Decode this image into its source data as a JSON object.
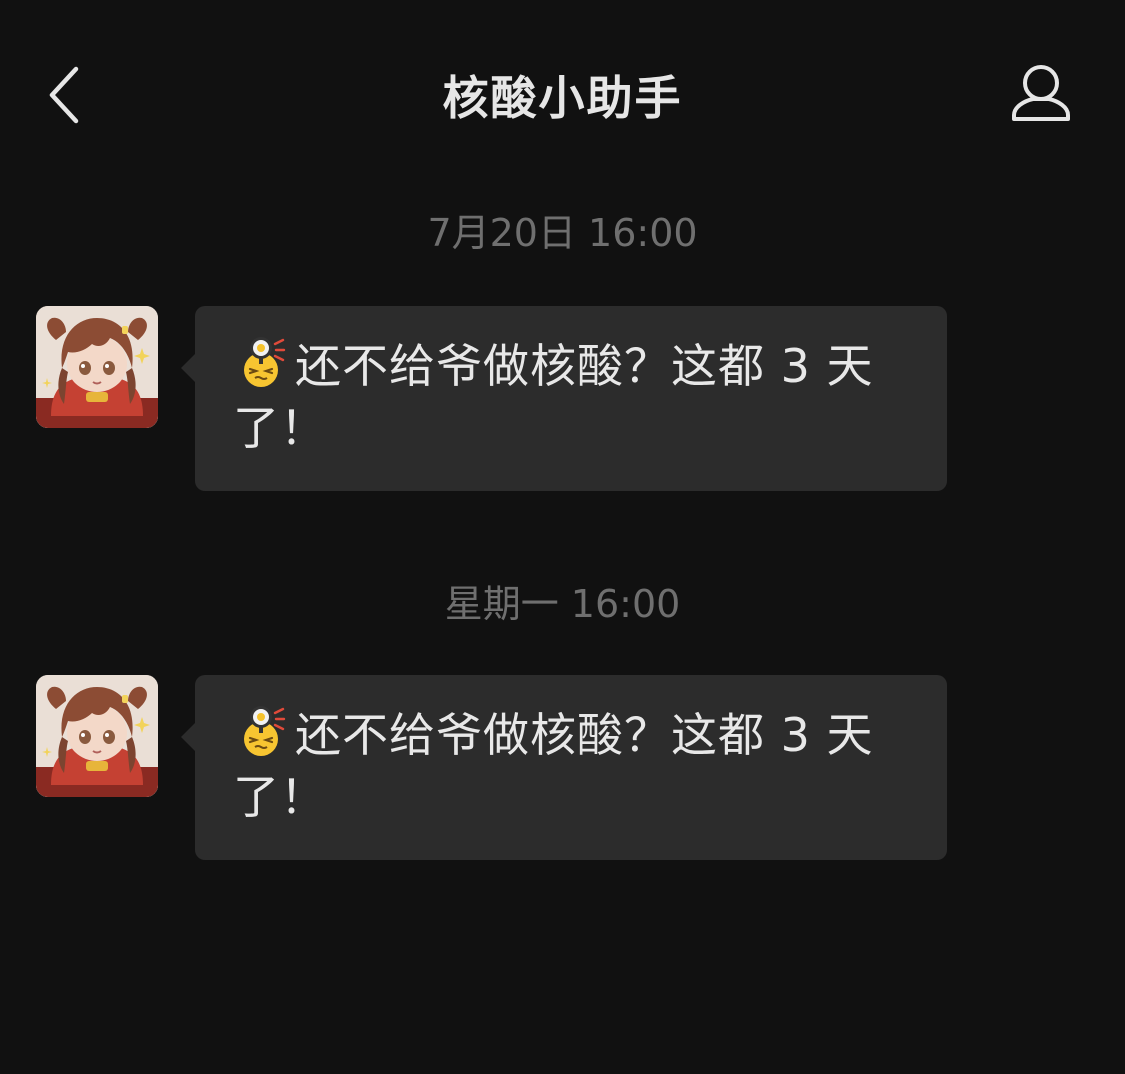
{
  "header": {
    "title": "核酸小助手",
    "back_icon": "chevron-left-icon",
    "profile_icon": "person-outline-icon"
  },
  "messages": [
    {
      "timestamp": "7月20日 16:00",
      "sender_avatar": "anime-girl-avatar",
      "emoji": "frying-pan-face-emoji",
      "text": "还不给爷做核酸？这都 3 天了！"
    },
    {
      "timestamp": "星期一 16:00",
      "sender_avatar": "anime-girl-avatar",
      "emoji": "frying-pan-face-emoji",
      "text": "还不给爷做核酸？这都 3 天了！"
    }
  ],
  "colors": {
    "background": "#111111",
    "bubble": "#2c2c2c",
    "text": "#e8e8e8",
    "timestamp": "#6f6f6f"
  }
}
